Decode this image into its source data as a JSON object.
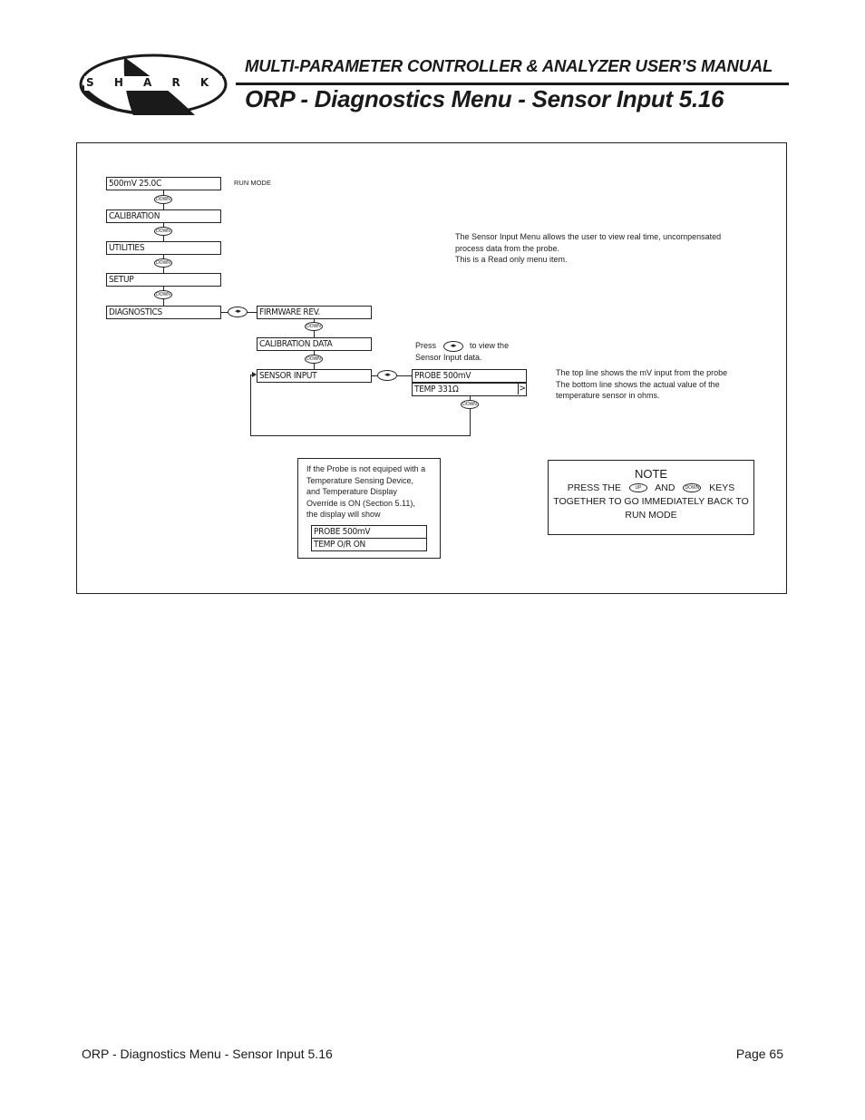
{
  "header": {
    "logo_text": "S H A R K",
    "manual_title": "MULTI-PARAMETER CONTROLLER & ANALYZER USER’S MANUAL",
    "page_title": "ORP - Diagnostics Menu - Sensor Input 5.16"
  },
  "diagram": {
    "main_menu": [
      {
        "label": "500mV   25.0C"
      },
      {
        "label": "CALIBRATION"
      },
      {
        "label": "UTILITIES"
      },
      {
        "label": "SETUP"
      },
      {
        "label": "DIAGNOSTICS"
      }
    ],
    "run_mode_label": "RUN MODE",
    "diagnostics_submenu": [
      {
        "label": "FIRMWARE REV."
      },
      {
        "label": "CALIBRATION DATA"
      },
      {
        "label": "SENSOR INPUT"
      }
    ],
    "sensor_display": {
      "line1": "PROBE    500mV",
      "line2": "TEMP      331Ω",
      "arrow": ">"
    },
    "keys": {
      "down": "DOWN",
      "up": "UP",
      "left_right": "◂ ▸"
    },
    "press_hint": {
      "prefix": "Press",
      "suffix": "to view the",
      "line2": "Sensor Input data."
    },
    "description": [
      "The Sensor Input Menu allows the user to view real time, uncompensated",
      "process data from the probe.",
      "This is a Read only menu item."
    ],
    "line_explanation": [
      "The top line shows the mV input from the probe",
      "The bottom line shows the actual value of the",
      "temperature sensor in ohms."
    ],
    "override_note": {
      "text": [
        "If the Probe is not equiped with a",
        "Temperature Sensing Device,",
        "and Temperature Display",
        "Override is ON (Section 5.11),",
        "the display will show"
      ],
      "line1": "PROBE    500mV",
      "line2": "TEMP O/R ON"
    },
    "note": {
      "title": "NOTE",
      "press_the": "PRESS THE",
      "and": "AND",
      "keys": "KEYS",
      "line2": "TOGETHER TO GO IMMEDIATELY BACK TO",
      "line3": "RUN MODE"
    }
  },
  "footer": {
    "left": "ORP - Diagnostics Menu - Sensor Input 5.16",
    "right": "Page 65"
  }
}
